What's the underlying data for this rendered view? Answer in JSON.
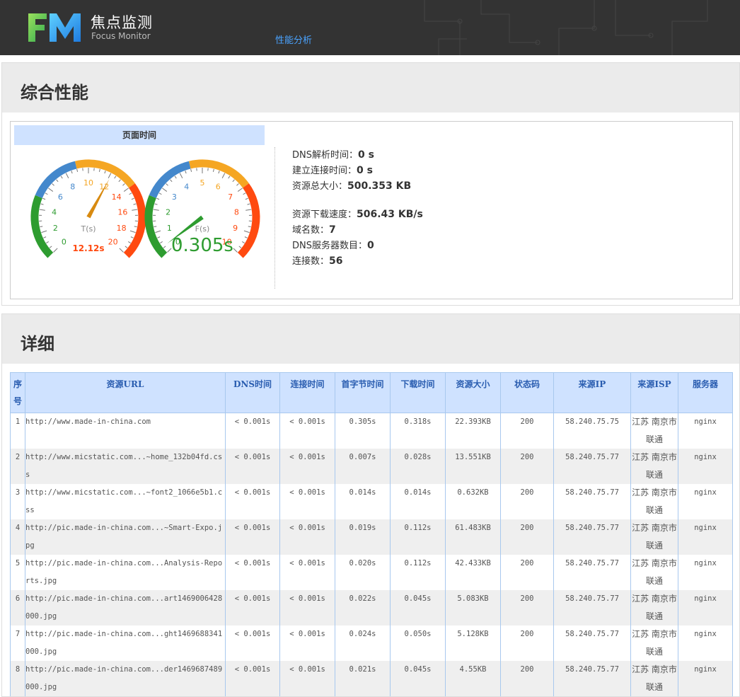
{
  "header": {
    "logo_mark": "FM",
    "logo_cn": "焦点监测",
    "logo_en": "Focus Monitor",
    "nav_link": "性能分析"
  },
  "overview": {
    "title": "综合性能",
    "gauge_panel_title": "页面时间",
    "gauge_t": {
      "label": "T(s)",
      "value_text": "12.12s",
      "value": 12.12,
      "ticks": [
        "0",
        "2",
        "4",
        "6",
        "8",
        "10",
        "12",
        "14",
        "16",
        "18",
        "20"
      ]
    },
    "gauge_f": {
      "label": "F(s)",
      "value_text": "0.305s",
      "value": 0.305,
      "ticks": [
        "0",
        "1",
        "2",
        "3",
        "4",
        "5",
        "6",
        "7",
        "8",
        "9",
        "10"
      ]
    },
    "stats": [
      {
        "label": "DNS解析时间：",
        "value": "0 s"
      },
      {
        "label": "建立连接时间：",
        "value": "0 s"
      },
      {
        "label": "资源总大小：",
        "value": "500.353 KB"
      },
      {
        "label": "资源下载速度：",
        "value": "506.43 KB/s"
      },
      {
        "label": "域名数：",
        "value": "7"
      },
      {
        "label": "DNS服务器数目：",
        "value": "0"
      },
      {
        "label": "连接数：",
        "value": "56"
      }
    ]
  },
  "details": {
    "title": "详细",
    "columns": [
      "序号",
      "资源URL",
      "DNS时间",
      "连接时间",
      "首字节时间",
      "下载时间",
      "资源大小",
      "状态码",
      "来源IP",
      "来源ISP",
      "服务器"
    ],
    "rows": [
      [
        "1",
        "http://www.made-in-china.com",
        "< 0.001s",
        "< 0.001s",
        "0.305s",
        "0.318s",
        "22.393KB",
        "200",
        "58.240.75.75",
        "江苏 南京市 联通",
        "nginx"
      ],
      [
        "2",
        "http://www.micstatic.com...~home_132b04fd.css",
        "< 0.001s",
        "< 0.001s",
        "0.007s",
        "0.028s",
        "13.551KB",
        "200",
        "58.240.75.77",
        "江苏 南京市 联通",
        "nginx"
      ],
      [
        "3",
        "http://www.micstatic.com...~font2_1066e5b1.css",
        "< 0.001s",
        "< 0.001s",
        "0.014s",
        "0.014s",
        "0.632KB",
        "200",
        "58.240.75.77",
        "江苏 南京市 联通",
        "nginx"
      ],
      [
        "4",
        "http://pic.made-in-china.com...~Smart-Expo.jpg",
        "< 0.001s",
        "< 0.001s",
        "0.019s",
        "0.112s",
        "61.483KB",
        "200",
        "58.240.75.77",
        "江苏 南京市 联通",
        "nginx"
      ],
      [
        "5",
        "http://pic.made-in-china.com...Analysis-Reports.jpg",
        "< 0.001s",
        "< 0.001s",
        "0.020s",
        "0.112s",
        "42.433KB",
        "200",
        "58.240.75.77",
        "江苏 南京市 联通",
        "nginx"
      ],
      [
        "6",
        "http://pic.made-in-china.com...art1469006428000.jpg",
        "< 0.001s",
        "< 0.001s",
        "0.022s",
        "0.045s",
        "5.083KB",
        "200",
        "58.240.75.77",
        "江苏 南京市 联通",
        "nginx"
      ],
      [
        "7",
        "http://pic.made-in-china.com...ght1469688341000.jpg",
        "< 0.001s",
        "< 0.001s",
        "0.024s",
        "0.050s",
        "5.128KB",
        "200",
        "58.240.75.77",
        "江苏 南京市 联通",
        "nginx"
      ],
      [
        "8",
        "http://pic.made-in-china.com...der1469687489000.jpg",
        "< 0.001s",
        "< 0.001s",
        "0.021s",
        "0.045s",
        "4.55KB",
        "200",
        "58.240.75.77",
        "江苏 南京市 联通",
        "nginx"
      ]
    ]
  }
}
